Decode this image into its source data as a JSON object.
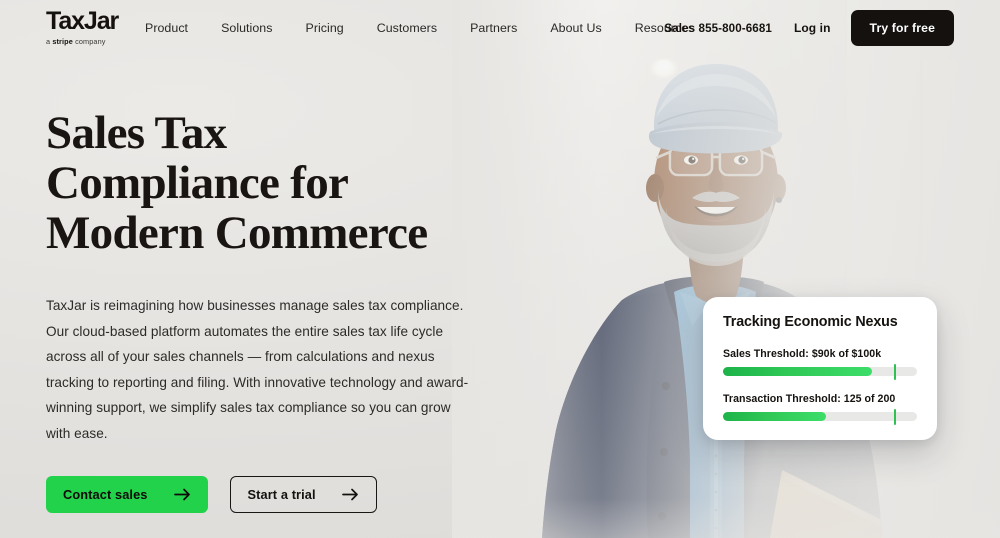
{
  "nav": {
    "logo": {
      "word": "TaxJar",
      "tagline_pre": "a ",
      "tagline_brand": "stripe",
      "tagline_post": " company"
    },
    "links": [
      {
        "label": "Product"
      },
      {
        "label": "Solutions"
      },
      {
        "label": "Pricing"
      },
      {
        "label": "Customers"
      },
      {
        "label": "Partners"
      },
      {
        "label": "About Us"
      },
      {
        "label": "Resources"
      }
    ],
    "sales_phone": "Sales 855-800-6681",
    "login_label": "Log in",
    "cta_label": "Try for free"
  },
  "hero": {
    "headline_line1": "Sales Tax",
    "headline_line2": "Compliance for",
    "headline_line3": "Modern Commerce",
    "paragraph": "TaxJar is reimagining how businesses manage sales tax compliance. Our cloud-based platform automates the entire sales tax life cycle across all of your sales channels — from calculations and nexus tracking to reporting and filing. With innovative technology and award-winning support, we simplify sales tax compliance so you can grow with ease.",
    "cta_primary": "Contact sales",
    "cta_secondary": "Start a trial"
  },
  "card": {
    "title": "Tracking Economic Nexus",
    "metrics": [
      {
        "label": "Sales Threshold: $90k of $100k",
        "current": "$90k",
        "target": "$100k",
        "fill_percent": 77,
        "marker_percent": 88
      },
      {
        "label": "Transaction Threshold: 125 of 200",
        "current": "125",
        "target": "200",
        "fill_percent": 53,
        "marker_percent": 88
      }
    ]
  },
  "colors": {
    "accent_green": "#23d24b",
    "bar_green_dark": "#1db34a",
    "bar_green_light": "#3ddd6a",
    "ink": "#14110f",
    "page_bg": "#e4e3e1"
  },
  "photo": {
    "alt": "Smiling man wearing a light grey flat cap, clear-framed glasses, grey beard, denim shirt and navy suede jacket, holding a tan folder, standing in a bright white interior"
  }
}
